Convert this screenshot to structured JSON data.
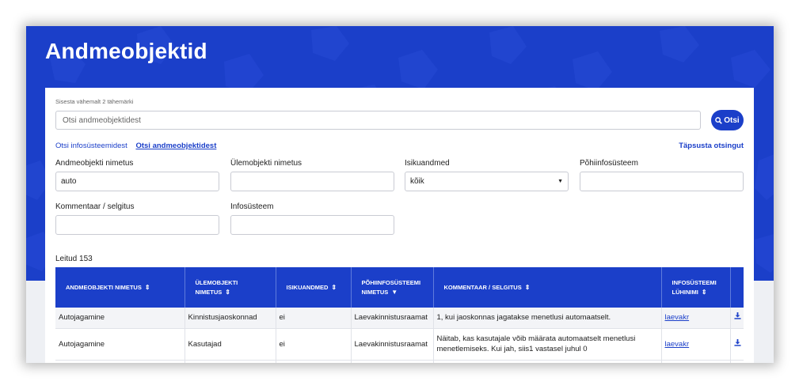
{
  "page": {
    "title": "Andmeobjektid"
  },
  "colors": {
    "brand": "#1b3fc9",
    "hero_pattern": "#2447d1",
    "link": "#1b3fc9"
  },
  "search": {
    "hint": "Sisesta vähemalt 2 tähemärki",
    "placeholder": "Otsi andmeobjektidest",
    "value": "",
    "button_label": "Otsi",
    "button_icon": "search-icon"
  },
  "tabs": {
    "systems": "Otsi infosüsteemidest",
    "objects": "Otsi andmeobjektidest",
    "active": "objects"
  },
  "refine_label": "Täpsusta otsingut",
  "filters": {
    "object_name": {
      "label": "Andmeobjekti nimetus",
      "value": "auto"
    },
    "parent_name": {
      "label": "Ülemobjekti nimetus",
      "value": ""
    },
    "personal_data": {
      "label": "Isikuandmed",
      "value": "kõik",
      "icon": "chevron-down-icon"
    },
    "main_system": {
      "label": "Põhiinfosüsteem",
      "value": ""
    },
    "comment": {
      "label": "Kommentaar / selgitus",
      "value": ""
    },
    "system": {
      "label": "Infosüsteem",
      "value": ""
    }
  },
  "results": {
    "count_label": "Leitud 153",
    "columns": [
      {
        "label": "Andmeobjekti nimetus",
        "sort": "both"
      },
      {
        "label": "Ülemobjekti nimetus",
        "sort": "both"
      },
      {
        "label": "Isikuandmed",
        "sort": "both"
      },
      {
        "label": "Põhiinfosüsteemi nimetus",
        "sort": "descending"
      },
      {
        "label": "Kommentaar / selgitus",
        "sort": "both"
      },
      {
        "label": "Infosüsteemi lühinimi",
        "sort": "both"
      },
      {
        "label": "",
        "sort": "none"
      }
    ],
    "sort_icons": {
      "both": "⇕",
      "descending": "▼"
    },
    "rows": [
      {
        "object": "Autojagamine",
        "parent": "Kinnistusjaoskonnad",
        "personal": "ei",
        "main_system": "Laevakinnistusraamat",
        "comment": "1, kui jaoskonnas jagatakse menetlusi automaatselt.",
        "short_name": "laevakr",
        "action_icon": "download-icon"
      },
      {
        "object": "Autojagamine",
        "parent": "Kasutajad",
        "personal": "ei",
        "main_system": "Laevakinnistusraamat",
        "comment": "Näitab, kas kasutajale võib määrata automaatselt menetlusi menetlemiseks. Kui jah, siis1 vastasel juhul 0",
        "short_name": "laevakr",
        "action_icon": "download-icon"
      }
    ]
  }
}
